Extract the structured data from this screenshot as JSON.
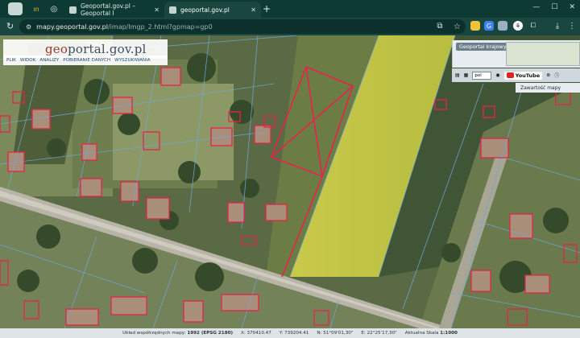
{
  "browser": {
    "tabs": [
      {
        "title": "Geoportal.gov.pl – Geoportal I",
        "active": false
      },
      {
        "title": "geoportal.gov.pl",
        "active": true
      }
    ],
    "address": {
      "host": "mapy.geoportal.gov.pl",
      "path": "/imap/Imgp_2.html?gpmap=gp0"
    }
  },
  "geoportal": {
    "logo": {
      "part1": "geo",
      "part2": "portal.gov.pl"
    },
    "menu": [
      "PLIK",
      "WIDOK",
      "ANALIZY",
      "POBIERANIE DANYCH",
      "WYSZUKIWANIA"
    ]
  },
  "right_panel": {
    "title": "Geoportal krajowy",
    "language": "pol",
    "youtube_label": "YouTube",
    "content_label": "Zawartość mapy"
  },
  "status": {
    "label": "Układ współrzędnych mapy:",
    "crs": "1992 (EPSG 2180)",
    "x": "X: 370410.47",
    "y": "Y: 739204.41",
    "n": "N: 51°09'01,30\"",
    "e": "E: 22°25'17,30\"",
    "scale_label": "Aktualna Skala",
    "scale": "1:1000"
  },
  "colors": {
    "parcel_highlight": "#e8224b",
    "boundary_lines": "#6fa8d6"
  }
}
